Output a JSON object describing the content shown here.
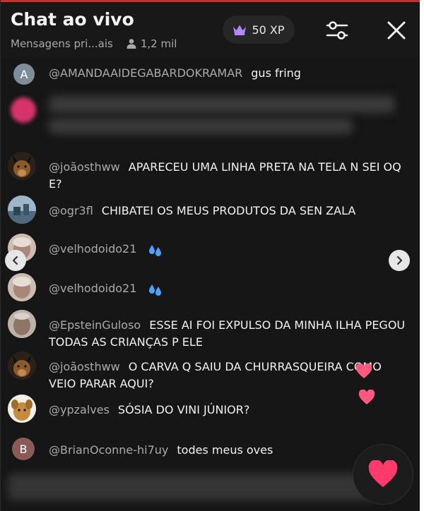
{
  "header": {
    "title": "Chat ao vivo",
    "mode_label": "Mensagens pri...ais",
    "viewer_count": "1,2 mil",
    "xp_label": "50 XP"
  },
  "messages": [
    {
      "avatar_letter": "A",
      "avatar_color": "#7f8c99",
      "user": "@AMANDAAIDEGABARDOKRAMAR",
      "text": "gus fring"
    },
    {
      "avatar_type": "blurred-pink",
      "avatar_color": "#d6336c",
      "user": "",
      "text": "",
      "blurred": true
    },
    {
      "avatar_type": "dog-photo",
      "avatar_color": "#2b2118",
      "user": "@joãosthww",
      "text": "APARECEU UMA LINHA PRETA NA TELA N SEI OQ E?"
    },
    {
      "avatar_type": "landscape-photo",
      "avatar_color": "#6b8aa3",
      "user": "@ogr3fl",
      "text": "CHIBATEI OS MEUS PRODUTOS DA SEN ZALA"
    },
    {
      "avatar_type": "face-photo",
      "avatar_color": "#bfa69a",
      "user": "@velhodoido21",
      "text": "",
      "emoji": "water-drops-icon"
    },
    {
      "avatar_type": "face-photo",
      "avatar_color": "#bfa69a",
      "user": "@velhodoido21",
      "text": "",
      "emoji": "water-drops-icon"
    },
    {
      "avatar_type": "face-photo",
      "avatar_color": "#9a8c82",
      "user": "@EpsteinGuloso",
      "text": "ESSE AI FOI EXPULSO DA MINHA ILHA PEGOU TODAS AS CRIANÇAS P ELE"
    },
    {
      "avatar_type": "dog-photo",
      "avatar_color": "#2b2118",
      "user": "@joãosthww",
      "text": "O CARVA Q SAIU DA CHURRASQUEIRA COMO VEIO PARAR AQUI?"
    },
    {
      "avatar_type": "dog-photo-tan",
      "avatar_color": "#c58b3f",
      "user": "@ypzalves",
      "text": "SÓSIA DO VINI JÚNIOR?"
    },
    {
      "avatar_letter": "B",
      "avatar_color": "#8a5a56",
      "user": "@BrianOconne-hi7uy",
      "text": "todes meus oves"
    }
  ],
  "colors": {
    "background": "#161616",
    "username": "#aaaaaa",
    "message_text": "#f2f2f2",
    "accent_red": "#c4302b",
    "heart": "#ff3b6b",
    "crown": "#b388ff"
  },
  "icons": [
    "person-icon",
    "crown-icon",
    "settings-sliders-icon",
    "close-icon",
    "chevron-left-icon",
    "chevron-right-icon",
    "heart-icon",
    "water-drops-icon"
  ]
}
